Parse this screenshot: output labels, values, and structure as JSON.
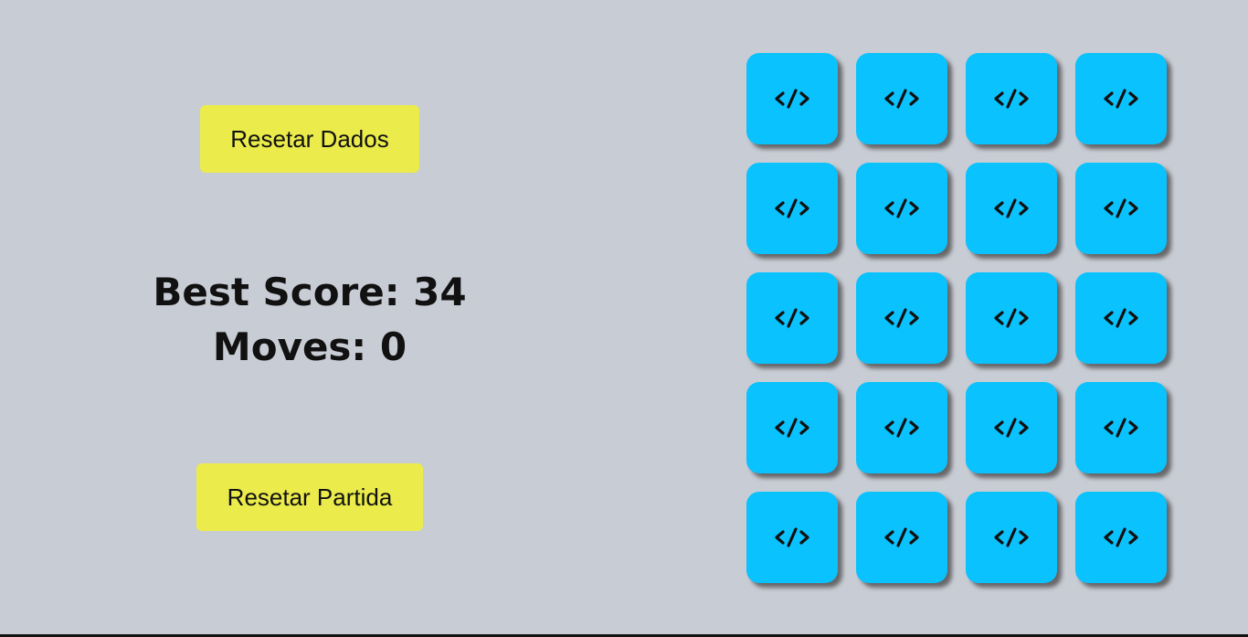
{
  "buttons": {
    "reset_data_label": "Resetar Dados",
    "reset_match_label": "Resetar Partida"
  },
  "stats": {
    "best_score_label": "Best Score: 34",
    "moves_label": "Moves: 0"
  },
  "board": {
    "rows": 5,
    "columns": 4,
    "cards": [
      {
        "face": "code-icon"
      },
      {
        "face": "code-icon"
      },
      {
        "face": "code-icon"
      },
      {
        "face": "code-icon"
      },
      {
        "face": "code-icon"
      },
      {
        "face": "code-icon"
      },
      {
        "face": "code-icon"
      },
      {
        "face": "code-icon"
      },
      {
        "face": "code-icon"
      },
      {
        "face": "code-icon"
      },
      {
        "face": "code-icon"
      },
      {
        "face": "code-icon"
      },
      {
        "face": "code-icon"
      },
      {
        "face": "code-icon"
      },
      {
        "face": "code-icon"
      },
      {
        "face": "code-icon"
      },
      {
        "face": "code-icon"
      },
      {
        "face": "code-icon"
      },
      {
        "face": "code-icon"
      },
      {
        "face": "code-icon"
      }
    ]
  },
  "colors": {
    "background": "#c8ccd4",
    "button": "#ebeb4c",
    "card": "#0ac2fe",
    "text": "#111111"
  }
}
